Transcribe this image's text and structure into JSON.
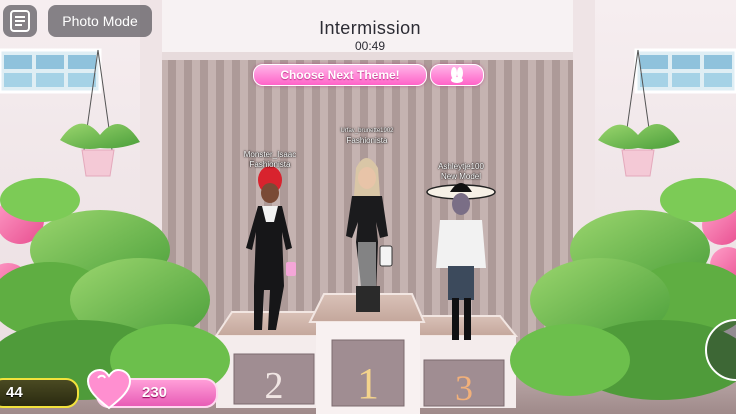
{
  "hud": {
    "menu_icon": "chat-icon",
    "photo_mode_label": "Photo Mode",
    "bunny_icon": "bunny-ears-icon"
  },
  "header": {
    "title": "Intermission",
    "timer": "00:49",
    "theme_button": "Choose Next Theme!"
  },
  "podium": {
    "place_1": "1",
    "place_2": "2",
    "place_3": "3"
  },
  "players": [
    {
      "name": "Monster_Isaac",
      "rank": "Fashionista"
    },
    {
      "name": "Urfav_brunette1902",
      "rank": "Fashionista"
    },
    {
      "name": "Ashleytje100",
      "rank": "New Model"
    }
  ],
  "currency": {
    "coins": "44",
    "hearts": "230"
  },
  "colors": {
    "accent_pink": "#ff63c8",
    "coin_border": "#f2e23c"
  }
}
